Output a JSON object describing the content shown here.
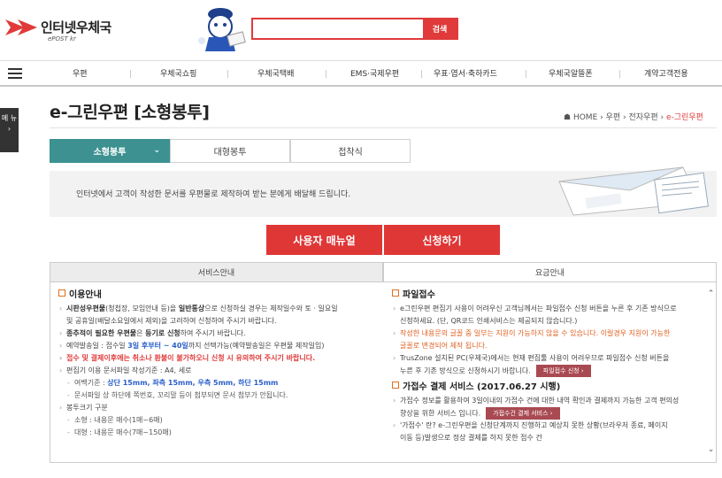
{
  "brand": {
    "name": "인터넷우체국",
    "sub": "ePOST kr"
  },
  "search": {
    "value": "",
    "placeholder": "",
    "button": "검색"
  },
  "nav": [
    "우편",
    "우체국쇼핑",
    "우체국택배",
    "EMS·국제우편",
    "우표·엽서·축하카드",
    "우체국알뜰폰",
    "계약고객전용"
  ],
  "side_menu": "메 뉴",
  "page_title": "e-그린우편 [소형봉투]",
  "breadcrumb": {
    "home": "HOME",
    "items": [
      "우편",
      "전자우편"
    ],
    "current": "e-그린우편"
  },
  "subtabs": [
    "소형봉투",
    "대형봉투",
    "접착식"
  ],
  "info": "인터넷에서 고객이 작성한 문서를 우편물로 제작하여 받는 분에게 배달해 드립니다.",
  "buttons": {
    "manual": "사용자 매뉴얼",
    "apply": "신청하기"
  },
  "content_tabs": [
    "서비스안내",
    "요금안내"
  ],
  "left": {
    "h1": "이용안내",
    "l1a": "시판성우편물",
    "l1b": "(청첩장, 모임안내 등)을 ",
    "l1c": "일반통상",
    "l1d": "으로 신청하실 경우는 제작일수와 토 · 일요일",
    "l1e": "및 공휴일(배달소요일에서 제외)을 고려하여 신청하여 주시기 바랍니다.",
    "l2a": "종추적이 필요한 우편물",
    "l2b": "은 ",
    "l2c": "등기로 신청",
    "l2d": "하여 주시기 바랍니다.",
    "l3a": "예약발송일 : 접수일 ",
    "l3b": "3일 후부터 ~ 40일",
    "l3c": "까지 선택가능(예약발송일은 우편물 제작일임)",
    "l4": "접수 및 결제이후에는 취소나 환불이 불가하오니 신청 시 유의하여 주시기 바랍니다.",
    "l5": "편집기 이용 문서파일 작성기준 : A4, 세로",
    "l6a": "여백기준 : ",
    "l6b": "상단 15mm, 좌측 15mm, 우측 5mm, 하단 15mm",
    "l7": "문서파일 상 하단에 쪽번호, 꼬리말 등이 첨부되면 문서 첨부가 안됩니다.",
    "l8": "봉투크기 구분",
    "l9": "소형 : 내용문 매수(1매~6매)",
    "l10": "대형 : 내용문 매수(7매~150매)"
  },
  "right": {
    "h1": "파일접수",
    "r1": "e그린우편 편집기 사용이 어려우신 고객님께서는 파일접수 신청 버튼을 누른 후 기존 방식으로",
    "r1b": "신청하세요. (단, QR코드 인쇄서비스는 제공되지 않습니다.)",
    "r2": "작성한 내용문의 글꼴 중 일부는 지원이 가능하지 않을 수 있습니다. 이럴경우 지원이 가능한",
    "r2b": "글꼴로 변경되어 제작 됩니다.",
    "r3": "TrusZone 설치된 PC(우체국)에서는 현재 편집툴 사용이 어려우므로 파일접수 신청 버튼을",
    "r3b": "누른 후 기존 방식으로 신청하시기 바랍니다.",
    "pill1": "파일접수 신청  ›",
    "h2": "가접수 결제 서비스 (2017.06.27 시행)",
    "r4": "가접수 정보를 활용하여 3일이내의 가접수 건에 대한 내역 확인과 결제까지 가능한 고객 편의성",
    "r4b": "향상을 위한 서비스 입니다.",
    "pill2": "가접수건 결제 서비스  ›",
    "r5": "'가접수' 란? e-그린우편을 신청단계까지 진행하고 예상치 못한 상황(브라우저 종료, 페이지",
    "r5b": "이동 등)발생으로 정상 결제를 하지 못한 접수 건"
  },
  "colors": {
    "accent": "#e03a3a",
    "tab_active": "#3d9191"
  }
}
